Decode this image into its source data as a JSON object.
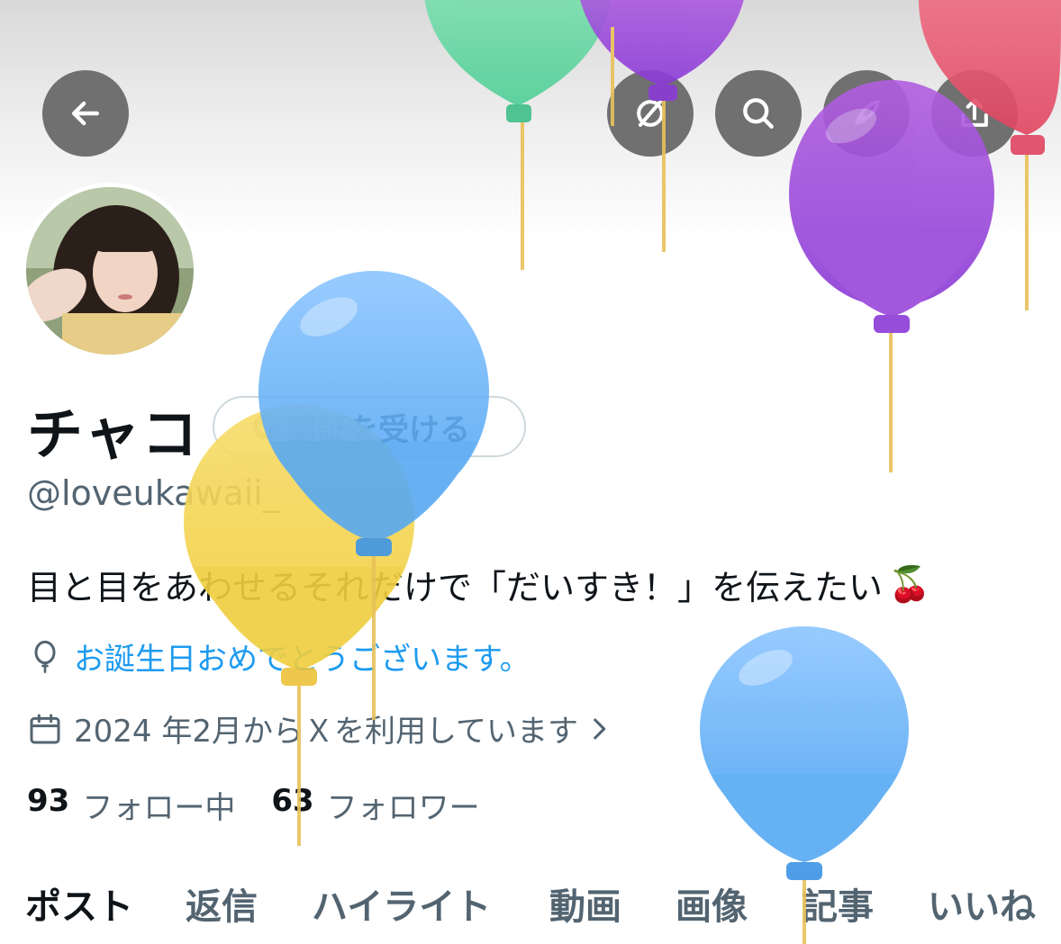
{
  "profile": {
    "display_name": "チャコ",
    "handle": "@loveukawaii_",
    "verify_label": "認証を受ける",
    "bio": "目と目をあわせるそれだけで「だいすき！」を伝えたい",
    "bio_emoji": "🍒",
    "location": "お誕生日おめでとうございます。",
    "joined": "2024 年2月からＸを利用しています",
    "following_count": "93",
    "following_label": "フォロー中",
    "followers_count": "63",
    "followers_label": "フォロワー"
  },
  "tabs": [
    "ポスト",
    "返信",
    "ハイライト",
    "動画",
    "画像",
    "記事",
    "いいね"
  ],
  "icons": {
    "back": "arrow-left-icon",
    "grok": "grok-icon",
    "search": "search-icon",
    "edit": "feather-icon",
    "share": "share-icon",
    "location": "balloon-icon",
    "calendar": "calendar-icon"
  },
  "colors": {
    "accent": "#1d9bf0",
    "muted": "#536471",
    "text": "#0f1419"
  }
}
